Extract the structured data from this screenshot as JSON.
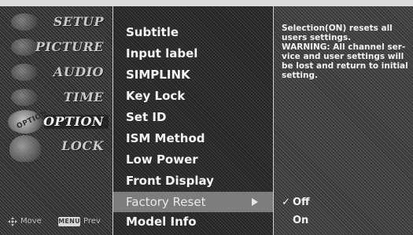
{
  "left_nav": {
    "items": [
      {
        "label": "SETUP",
        "icon": "setup-icon"
      },
      {
        "label": "PICTURE",
        "icon": "picture-icon"
      },
      {
        "label": "AUDIO",
        "icon": "audio-icon"
      },
      {
        "label": "TIME",
        "icon": "time-icon"
      },
      {
        "label": "OPTION",
        "icon": "option-icon",
        "active": true,
        "icon_text": "OPTION"
      },
      {
        "label": "LOCK",
        "icon": "lock-icon"
      }
    ],
    "footer": {
      "move_label": "Move",
      "menu_key": "MENU",
      "prev_label": "Prev"
    }
  },
  "menu": {
    "items": [
      {
        "label": "Subtitle"
      },
      {
        "label": "Input label"
      },
      {
        "label": "SIMPLINK"
      },
      {
        "label": "Key Lock"
      },
      {
        "label": "Set ID"
      },
      {
        "label": "ISM Method"
      },
      {
        "label": "Low Power"
      },
      {
        "label": "Front Display"
      },
      {
        "label": "Factory Reset",
        "selected": true,
        "arrow": "right-arrow-icon"
      },
      {
        "label": "Model Info"
      }
    ]
  },
  "info_panel": {
    "description_line1": "Selection(ON) resets all\nusers settings.",
    "description_line2": " WARNING: All channel ser-\nvice and user settings will\nbe lost and return to initial\nsetting.",
    "options": [
      {
        "label": "Off",
        "checked": true,
        "check_mark": "✓"
      },
      {
        "label": "On",
        "checked": false,
        "check_mark": ""
      }
    ]
  },
  "colors": {
    "selected_row": "#7d7d7d",
    "top_band": "#dcdcdc"
  }
}
